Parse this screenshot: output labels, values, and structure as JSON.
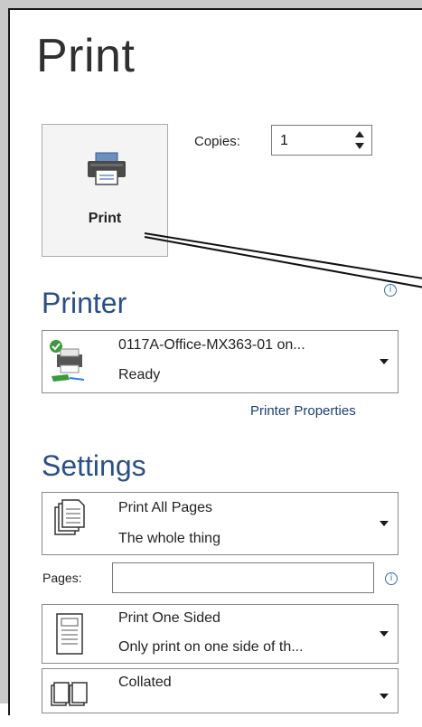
{
  "window": {
    "title": "Print"
  },
  "print_button": {
    "label": "Print",
    "icon": "printer-icon"
  },
  "copies": {
    "label": "Copies:",
    "value": "1"
  },
  "printer_section": {
    "title": "Printer",
    "selected": {
      "name": "0117A-Office-MX363-01 on...",
      "status": "Ready",
      "icon": "network-printer-icon"
    },
    "properties_link": "Printer Properties"
  },
  "settings_section": {
    "title": "Settings",
    "pages_range": {
      "title": "Print All Pages",
      "subtitle": "The whole thing",
      "icon": "all-pages-icon"
    },
    "pages": {
      "label": "Pages:",
      "value": ""
    },
    "sides": {
      "title": "Print One Sided",
      "subtitle": "Only print on one side of th...",
      "icon": "one-sided-icon"
    },
    "collation": {
      "title": "Collated",
      "icon": "collated-icon"
    }
  },
  "colors": {
    "accent": "#2b4f87",
    "link": "#1f3e70",
    "info": "#3a6cb3"
  }
}
